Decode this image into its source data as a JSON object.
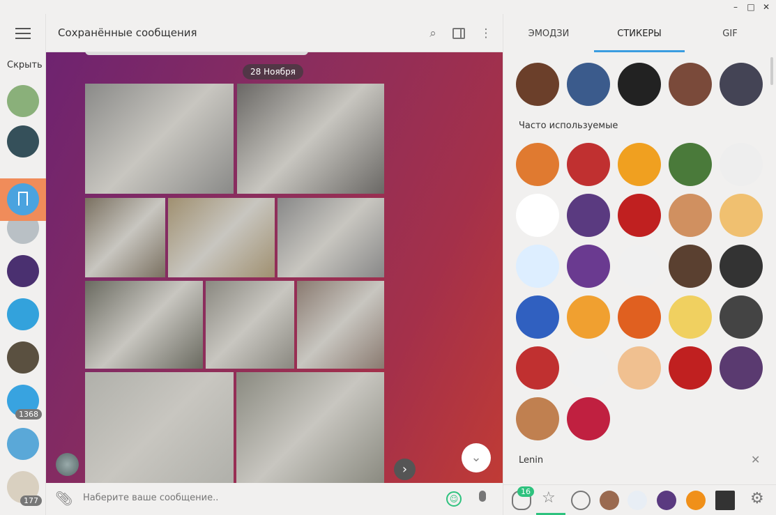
{
  "window": {
    "minimize": "–",
    "maximize": "□",
    "close": "✕"
  },
  "sidebar": {
    "hide_label": "Скрыть",
    "chats": [
      {
        "color": "#8ab07a"
      },
      {
        "color": "#35505a"
      },
      {
        "color": "#b9c0c5"
      },
      {
        "color": "#4a3070"
      },
      {
        "color": "#33a2dc"
      },
      {
        "color": "#5a5040"
      },
      {
        "color": "#38a3e0",
        "badge": "1368"
      },
      {
        "color": "#5aa8d8"
      },
      {
        "color": "#d9d0c0",
        "badge": "177"
      }
    ]
  },
  "header": {
    "title": "Сохранённые сообщения"
  },
  "chat": {
    "date": "28 Ноября",
    "input_placeholder": "Наберите ваше сообщение.."
  },
  "panel": {
    "tabs": [
      "ЭМОДЗИ",
      "СТИКЕРЫ",
      "GIF"
    ],
    "active_tab": 1,
    "frequent_label": "Часто используемые",
    "set_label": "Lenin",
    "recent_badge": "16",
    "top_stickers": [
      "#6b3f2a",
      "#3b5b8c",
      "#222",
      "#7a4a3a",
      "#445"
    ],
    "frequent_stickers": [
      "#e07a30",
      "#c03030",
      "#f0a020",
      "#4a7a3a",
      "#eee",
      "#fff",
      "#5a3a80",
      "#c02020",
      "#d09060",
      "#f0c070",
      "#ddeeff",
      "#6a3a90",
      "#f0f0f0",
      "#5a4030",
      "#333",
      "#3060c0",
      "#f0a030",
      "#e06020",
      "#f0d060",
      "#444",
      "#c03030",
      "#f0f0f0",
      "#f0c090",
      "#c02020",
      "#5a3a70",
      "#c08050",
      "#c02040"
    ],
    "accent": "#3a9de0",
    "green": "#2ec27e"
  }
}
